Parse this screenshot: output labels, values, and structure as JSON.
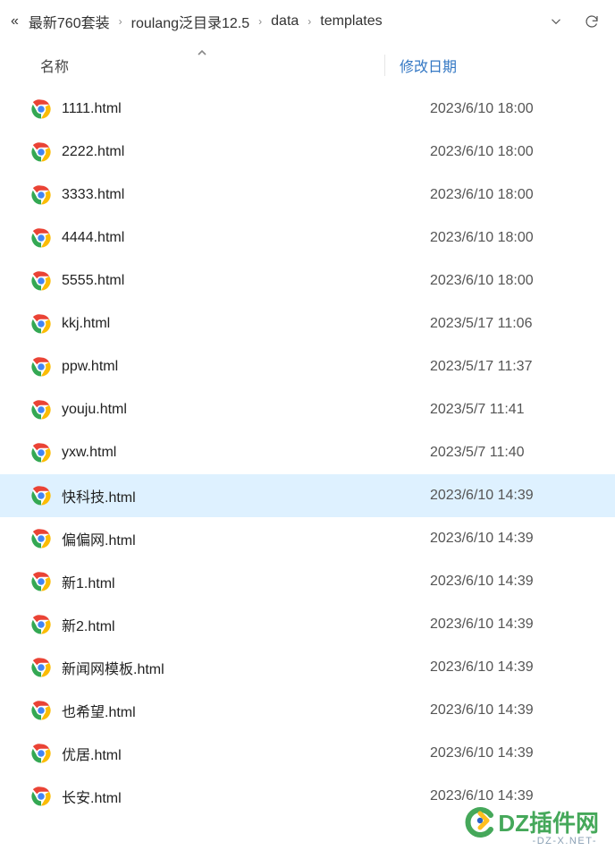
{
  "breadcrumb": {
    "overflow": "«",
    "items": [
      "最新760套装",
      "roulang泛目录12.5",
      "data",
      "templates"
    ],
    "sep": "›"
  },
  "columns": {
    "name": "名称",
    "date": "修改日期"
  },
  "files": [
    {
      "name": "1111.html",
      "date": "2023/6/10 18:00",
      "selected": false
    },
    {
      "name": "2222.html",
      "date": "2023/6/10 18:00",
      "selected": false
    },
    {
      "name": "3333.html",
      "date": "2023/6/10 18:00",
      "selected": false
    },
    {
      "name": "4444.html",
      "date": "2023/6/10 18:00",
      "selected": false
    },
    {
      "name": "5555.html",
      "date": "2023/6/10 18:00",
      "selected": false
    },
    {
      "name": "kkj.html",
      "date": "2023/5/17 11:06",
      "selected": false
    },
    {
      "name": "ppw.html",
      "date": "2023/5/17 11:37",
      "selected": false
    },
    {
      "name": "youju.html",
      "date": "2023/5/7 11:41",
      "selected": false
    },
    {
      "name": "yxw.html",
      "date": "2023/5/7 11:40",
      "selected": false
    },
    {
      "name": "快科技.html",
      "date": "2023/6/10 14:39",
      "selected": true
    },
    {
      "name": "偏偏网.html",
      "date": "2023/6/10 14:39",
      "selected": false
    },
    {
      "name": "新1.html",
      "date": "2023/6/10 14:39",
      "selected": false
    },
    {
      "name": "新2.html",
      "date": "2023/6/10 14:39",
      "selected": false
    },
    {
      "name": "新闻网模板.html",
      "date": "2023/6/10 14:39",
      "selected": false
    },
    {
      "name": "也希望.html",
      "date": "2023/6/10 14:39",
      "selected": false
    },
    {
      "name": "优居.html",
      "date": "2023/6/10 14:39",
      "selected": false
    },
    {
      "name": "长安.html",
      "date": "2023/6/10 14:39",
      "selected": false
    }
  ],
  "watermark": {
    "brand": "DZ插件网",
    "sub": "-DZ-X.NET-"
  }
}
